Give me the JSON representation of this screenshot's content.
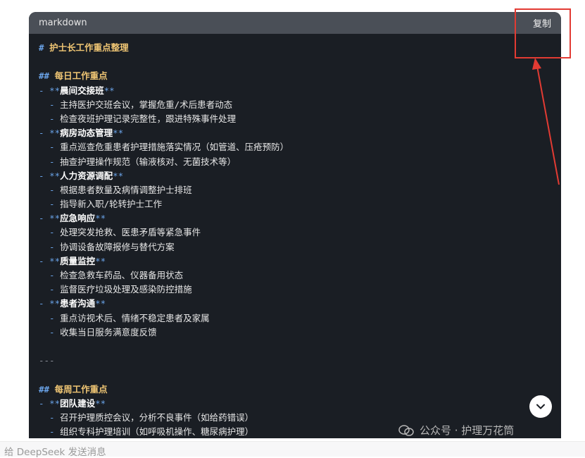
{
  "code_block": {
    "language": "markdown",
    "copy_label": "复制",
    "lines": [
      {
        "kind": "h1",
        "mark": "#",
        "text": "护士长工作重点整理"
      },
      {
        "kind": "blank"
      },
      {
        "kind": "h2",
        "mark": "##",
        "text": "每日工作重点"
      },
      {
        "kind": "bold",
        "text": "晨间交接班"
      },
      {
        "kind": "item",
        "text": "主持医护交班会议，掌握危重/术后患者动态"
      },
      {
        "kind": "item",
        "text": "检查夜班护理记录完整性，跟进特殊事件处理"
      },
      {
        "kind": "bold",
        "text": "病房动态管理"
      },
      {
        "kind": "item",
        "text": "重点巡查危重患者护理措施落实情况（如管道、压疮预防）"
      },
      {
        "kind": "item",
        "text": "抽查护理操作规范（输液核对、无菌技术等）"
      },
      {
        "kind": "bold",
        "text": "人力资源调配"
      },
      {
        "kind": "item",
        "text": "根据患者数量及病情调整护士排班"
      },
      {
        "kind": "item",
        "text": "指导新入职/轮转护士工作"
      },
      {
        "kind": "bold",
        "text": "应急响应"
      },
      {
        "kind": "item",
        "text": "处理突发抢救、医患矛盾等紧急事件"
      },
      {
        "kind": "item",
        "text": "协调设备故障报修与替代方案"
      },
      {
        "kind": "bold",
        "text": "质量监控"
      },
      {
        "kind": "item",
        "text": "检查急救车药品、仪器备用状态"
      },
      {
        "kind": "item",
        "text": "监督医疗垃圾处理及感染防控措施"
      },
      {
        "kind": "bold",
        "text": "患者沟通"
      },
      {
        "kind": "item",
        "text": "重点访视术后、情绪不稳定患者及家属"
      },
      {
        "kind": "item",
        "text": "收集当日服务满意度反馈"
      },
      {
        "kind": "blank"
      },
      {
        "kind": "hr",
        "text": "---"
      },
      {
        "kind": "blank"
      },
      {
        "kind": "h2",
        "mark": "##",
        "text": "每周工作重点"
      },
      {
        "kind": "bold",
        "text": "团队建设"
      },
      {
        "kind": "item",
        "text": "召开护理质控会议，分析不良事件（如给药错误）"
      },
      {
        "kind": "item",
        "text": "组织专科护理培训（如呼吸机操作、糖尿病护理）"
      }
    ]
  },
  "watermark": {
    "text": "公众号 · 护理万花筒"
  },
  "input": {
    "placeholder": "给 DeepSeek 发送消息"
  },
  "colors": {
    "annotation_red": "#e23b33",
    "code_bg": "#1a1e24",
    "header_bg": "#4a4f57"
  },
  "icons": {
    "scroll_down": "chevron-down-icon",
    "watermark_logo": "wechat-icon"
  }
}
